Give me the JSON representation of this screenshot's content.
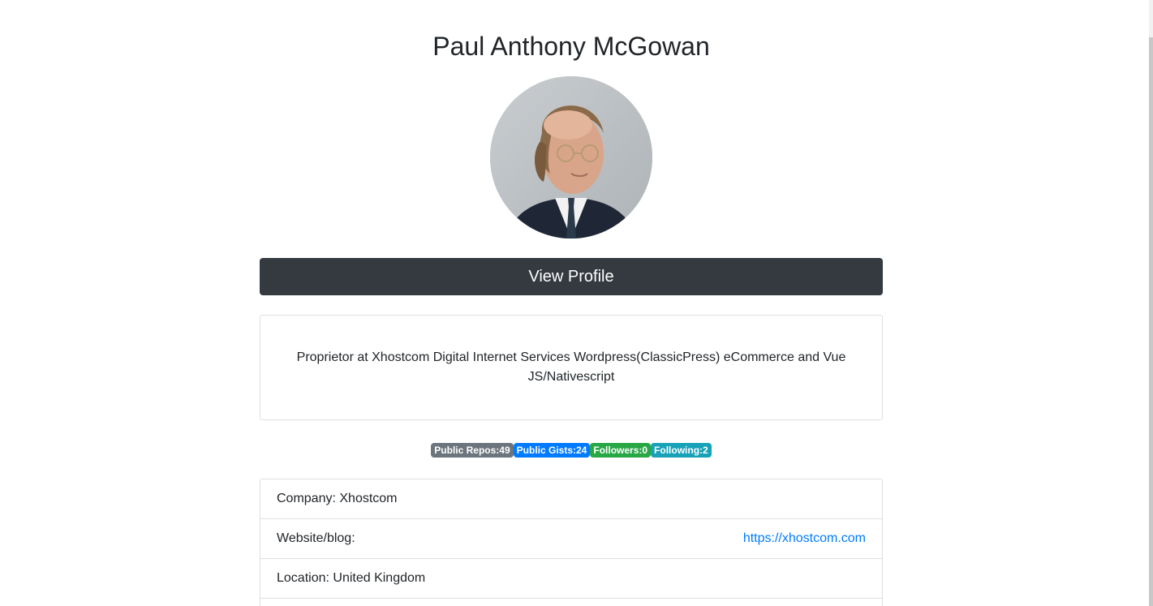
{
  "profile": {
    "name": "Paul Anthony McGowan",
    "avatar_alt": "Paul Anthony McGowan avatar",
    "view_profile_label": "View Profile",
    "bio": "Proprietor at Xhostcom Digital Internet Services Wordpress(ClassicPress) eCommerce and Vue JS/Nativescript"
  },
  "badges": [
    {
      "label": "Public Repos:49",
      "color": "#6c757d"
    },
    {
      "label": "Public Gists:24",
      "color": "#007bff"
    },
    {
      "label": "Followers:0",
      "color": "#28a745"
    },
    {
      "label": "Following:2",
      "color": "#17a2b8"
    }
  ],
  "details": {
    "company": "Company: Xhostcom",
    "website_label": "Website/blog:",
    "website_url": "https://xhostcom.com",
    "location": "Location: United Kingdom"
  },
  "colors": {
    "button_bg": "#343a40",
    "link": "#007bff"
  }
}
